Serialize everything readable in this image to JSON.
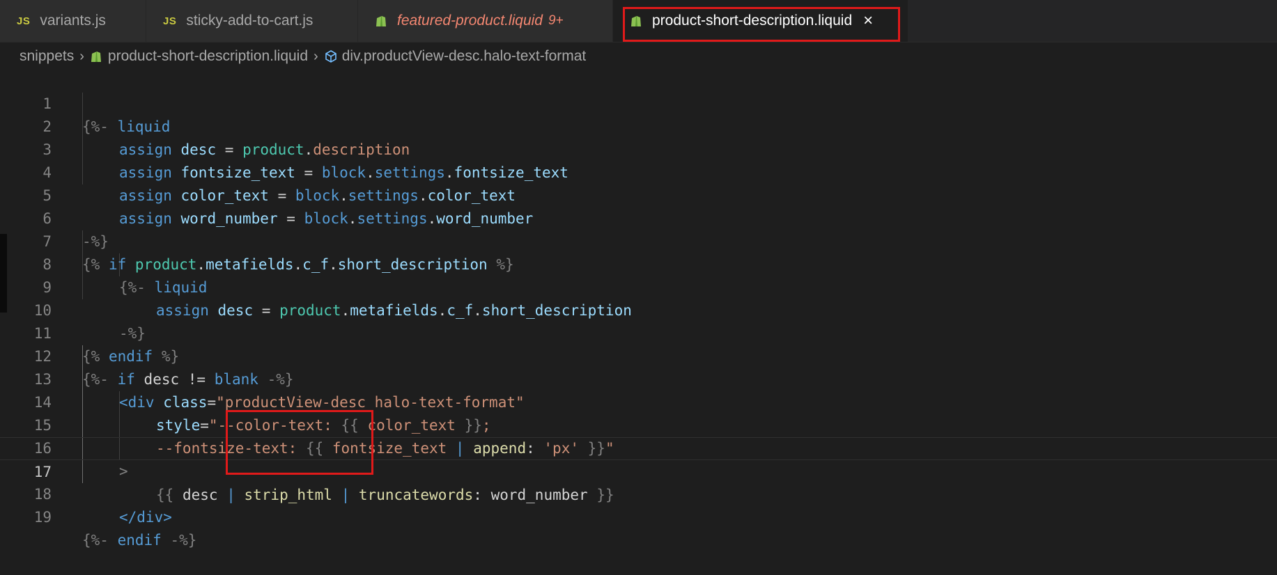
{
  "tabs": [
    {
      "label": "variants.js",
      "icon": "javascript-file-icon",
      "icon_text": "JS"
    },
    {
      "label": "sticky-add-to-cart.js",
      "icon": "javascript-file-icon",
      "icon_text": "JS"
    },
    {
      "label": "featured-product.liquid",
      "icon": "shopify-liquid-file-icon",
      "problems": "9+"
    },
    {
      "label": "product-short-description.liquid",
      "icon": "shopify-liquid-file-icon",
      "close": "×",
      "active": true
    }
  ],
  "breadcrumb": {
    "folder": "snippets",
    "file": "product-short-description.liquid",
    "symbol": "div.productView-desc.halo-text-format"
  },
  "editor": {
    "current_line": 17,
    "line_numbers": [
      "1",
      "2",
      "3",
      "4",
      "5",
      "6",
      "7",
      "8",
      "9",
      "10",
      "11",
      "12",
      "13",
      "14",
      "15",
      "16",
      "17",
      "18",
      "19"
    ]
  },
  "colors": {
    "keyword": "#569cd6",
    "variable": "#9cdcfe",
    "filter": "#dcdcaa",
    "string": "#ce9178",
    "object": "#4ec9b0",
    "highlight_box": "#e01a1a",
    "liquid_icon": "#8cc152",
    "js_icon": "#cbcb41"
  },
  "code": {
    "l1": [
      "{%-",
      "liquid"
    ],
    "l2": [
      "assign",
      "desc",
      "=",
      "product",
      ".",
      "description"
    ],
    "l3": [
      "assign",
      "fontsize_text",
      "=",
      "block",
      ".",
      "settings",
      ".",
      "fontsize_text"
    ],
    "l4": [
      "assign",
      "color_text",
      "=",
      "block",
      ".",
      "settings",
      ".",
      "color_text"
    ],
    "l5": [
      "assign",
      "word_number",
      "=",
      "block",
      ".",
      "settings",
      ".",
      "word_number"
    ],
    "l6": [
      "-%}"
    ],
    "l7": [
      "{%",
      "if",
      "product",
      ".",
      "metafields",
      ".",
      "c_f",
      ".",
      "short_description",
      "%}"
    ],
    "l8": [
      "{%-",
      "liquid"
    ],
    "l9": [
      "assign",
      "desc",
      "=",
      "product",
      ".",
      "metafields",
      ".",
      "c_f",
      ".",
      "short_description"
    ],
    "l10": [
      "-%}"
    ],
    "l11": [
      "{%",
      "endif",
      "%}"
    ],
    "l12": [
      "{%-",
      "if",
      "desc",
      "!=",
      "blank",
      "-%}"
    ],
    "l13": [
      "<div",
      "class",
      "=",
      "\"productView-desc halo-text-format\""
    ],
    "l14": [
      "style",
      "=",
      "\"--color-text: ",
      "{{",
      "color_text",
      "}}",
      ";"
    ],
    "l15": [
      "--fontsize-text: ",
      "{{",
      "fontsize_text",
      "|",
      "append",
      ":",
      "'px'",
      "}}",
      "\""
    ],
    "l16": [
      ">"
    ],
    "l17": [
      "{{",
      "desc",
      "|",
      "strip_html",
      "|",
      "truncatewords",
      ":",
      "word_number",
      "}}"
    ],
    "l18": [
      "</div>"
    ],
    "l19": [
      "{%-",
      "endif",
      "-%}"
    ]
  }
}
